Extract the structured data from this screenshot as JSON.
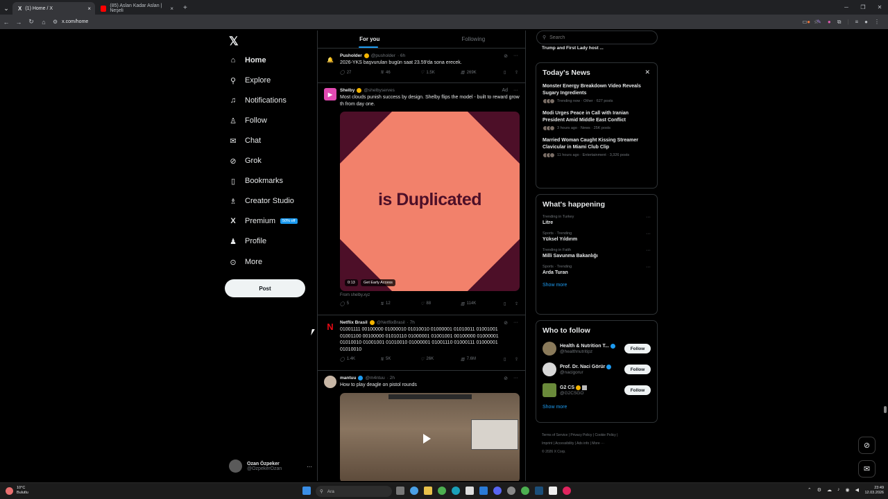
{
  "browser": {
    "tabs": [
      {
        "title": "(1) Home / X",
        "icon": "x-logo-icon",
        "color": "#ffffff"
      },
      {
        "title": "(85) Aslan Kadar Aslan | Neşeli",
        "icon": "youtube-icon",
        "color": "#ff0000"
      }
    ],
    "url": "x.com/home"
  },
  "sidebar": {
    "items": [
      {
        "label": "Home",
        "icon": "home-icon"
      },
      {
        "label": "Explore",
        "icon": "search-icon"
      },
      {
        "label": "Notifications",
        "icon": "bell-icon"
      },
      {
        "label": "Follow",
        "icon": "person-plus-icon"
      },
      {
        "label": "Chat",
        "icon": "mail-icon"
      },
      {
        "label": "Grok",
        "icon": "grok-icon"
      },
      {
        "label": "Bookmarks",
        "icon": "bookmark-icon"
      },
      {
        "label": "Creator Studio",
        "icon": "creator-icon"
      },
      {
        "label": "Premium",
        "icon": "x-logo-icon",
        "badge": "50% off"
      },
      {
        "label": "Profile",
        "icon": "person-icon"
      },
      {
        "label": "More",
        "icon": "more-circle-icon"
      }
    ],
    "post_label": "Post",
    "account": {
      "name": "Ozan Özpeker",
      "handle": "@OzpekerOzan"
    }
  },
  "timeline": {
    "tabs": [
      "For you",
      "Following"
    ],
    "tweets": [
      {
        "name": "Pusholder",
        "handle": "@pusholder",
        "time": "· 6h",
        "text": "2026-YKS başvuruları bugün saat 23.59'da sona erecek.",
        "replies": "27",
        "retweets": "46",
        "likes": "1.5K",
        "views": "269K"
      },
      {
        "name": "Shelby",
        "handle": "@shelbyserves",
        "ad": "Ad",
        "text": "Most clouds punish success by design. Shelby flips the model - built to reward growth from day one.",
        "media_text": "is Duplicated",
        "media_time": "0:13",
        "media_cta": "Get Early Access",
        "from": "From shelby.xyz",
        "replies": "5",
        "retweets": "12",
        "likes": "88",
        "views": "114K"
      },
      {
        "name": "Netflix Brasil",
        "handle": "@NetflixBrasil",
        "time": "· 7h",
        "text": "01001111 00100000 01000010 01010010 01000001 01010011 01001001 01001100 00100000 01010110 01000001 01001001 00100000 01000001 01010010 01001001 01010010 01000001 01001110 01000111 01000001 01010010",
        "replies": "1.4K",
        "retweets": "5K",
        "likes": "26K",
        "views": "7.6M"
      },
      {
        "name": "mantuu",
        "handle": "@m4ntuu",
        "time": "· 2h",
        "text": "How to play deagle on pistol rounds"
      }
    ]
  },
  "right": {
    "search_placeholder": "Search",
    "top_snippet": "Trump and First Lady host ...",
    "news_title": "Today's News",
    "news": [
      {
        "title": "Monster Energy Breakdown Video Reveals Sugary Ingredients",
        "meta": "Trending now · Other · 627 posts"
      },
      {
        "title": "Modi Urges Peace in Call with Iranian President Amid Middle East Conflict",
        "meta": "3 hours ago · News · 25K posts"
      },
      {
        "title": "Married Woman Caught Kissing Streamer Clavicular in Miami Club Clip",
        "meta": "11 hours ago · Entertainment · 3,326 posts"
      }
    ],
    "happening_title": "What's happening",
    "trends": [
      {
        "category": "Trending in Turkey",
        "name": "Litre"
      },
      {
        "category": "Sports · Trending",
        "name": "Yüksel Yıldırım"
      },
      {
        "category": "Trending in Fatih",
        "name": "Milli Savunma Bakanlığı"
      },
      {
        "category": "Sports · Trending",
        "name": "Arda Turan"
      }
    ],
    "show_more": "Show more",
    "wtf_title": "Who to follow",
    "wtf": [
      {
        "name": "Health & Nutrition T...",
        "handle": "@healthnutritipz"
      },
      {
        "name": "Prof. Dr. Naci Görür",
        "handle": "@nacigorur"
      },
      {
        "name": "G2 CS",
        "handle": "@G2CSGO"
      }
    ],
    "follow_label": "Follow",
    "footer": [
      "Terms of Service",
      "Privacy Policy",
      "Cookie Policy",
      "Imprint",
      "Accessibility",
      "Ads info",
      "More ···",
      "© 2026 X Corp."
    ]
  },
  "taskbar": {
    "weather_temp": "10°C",
    "weather_desc": "Bulutlu",
    "search_placeholder": "Ara",
    "time": "23:49",
    "date": "12.03.2026"
  },
  "colors": {
    "accent": "#1d9bf0",
    "promo_bg": "#4d0f28",
    "promo_fg": "#f2816b",
    "netflix": "#e50914"
  }
}
